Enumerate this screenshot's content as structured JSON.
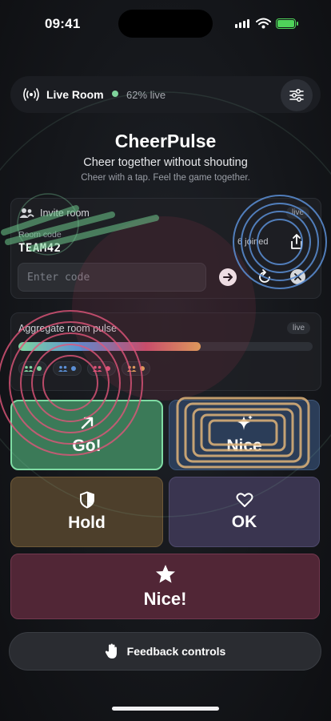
{
  "status_bar": {
    "time": "09:41"
  },
  "header": {
    "room_label": "Live Room",
    "live_percent": "62% live",
    "icons": {
      "broadcast": "broadcast-icon",
      "settings": "sliders-icon"
    }
  },
  "hero": {
    "title": "CheerPulse",
    "subtitle": "Cheer together without shouting",
    "tagline": "Cheer with a tap. Feel the game together."
  },
  "invite": {
    "title": "Invite room",
    "badge": "live",
    "code_label": "Room code",
    "code_value": "TEAM42",
    "joined": "6 joined",
    "input_placeholder": "Enter code",
    "icons": [
      "group-icon",
      "share-icon",
      "arrow-right-icon",
      "refresh-icon",
      "close-icon"
    ]
  },
  "pulse": {
    "title": "Aggregate room pulse",
    "badge": "live",
    "fill_fraction": 0.62,
    "chips": [
      {
        "icon": "crowd-icon",
        "color": "#7fd4a0"
      },
      {
        "icon": "crowd-icon",
        "color": "#5b8fd6"
      },
      {
        "icon": "crowd-icon",
        "color": "#e0557a"
      },
      {
        "icon": "crowd-icon",
        "color": "#e0a55c"
      }
    ]
  },
  "reactions": [
    {
      "label": "Go!",
      "icon": "arrow-up-right-icon"
    },
    {
      "label": "Nice",
      "icon": "sparkle-icon"
    },
    {
      "label": "Hold",
      "icon": "shield-icon"
    },
    {
      "label": "OK",
      "icon": "heart-icon"
    },
    {
      "label": "Nice!",
      "icon": "star-icon"
    }
  ],
  "feedback": {
    "label": "Feedback controls",
    "icon": "hand-icon"
  },
  "colors": {
    "go": "#7fdca4",
    "nice": "#d8b27a",
    "hold": "#6e5938",
    "ok": "#4f4a6c",
    "nice2": "#74384f"
  }
}
